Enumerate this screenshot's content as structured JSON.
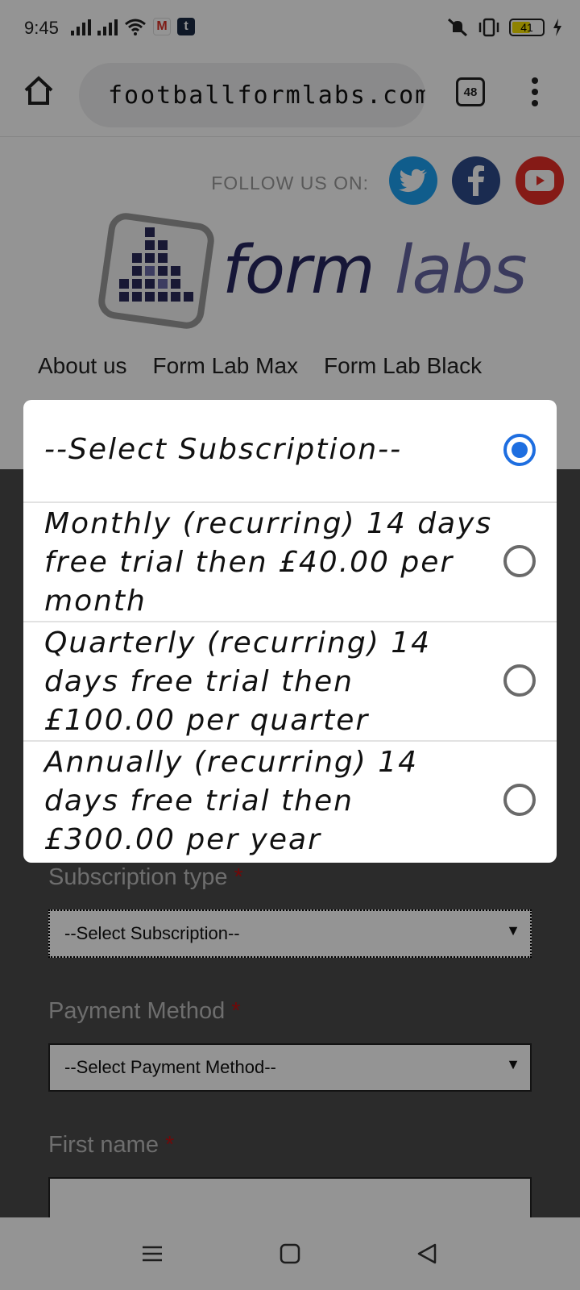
{
  "status_bar": {
    "time": "9:45",
    "battery_level": "41",
    "gmail_letter": "M",
    "tumblr_letter": "t",
    "icons": [
      "signal-icon",
      "signal-icon",
      "wifi-icon",
      "gmail-icon",
      "tumblr-icon",
      "mute-icon",
      "vibrate-icon",
      "battery-icon",
      "charging-icon"
    ]
  },
  "browser": {
    "url": "footballformlabs.com/R",
    "tab_count": "48",
    "icons": [
      "home-icon",
      "warning-icon",
      "tabs-icon",
      "more-icon"
    ]
  },
  "header": {
    "follow_label": "FOLLOW US ON:",
    "social": [
      "twitter-icon",
      "facebook-icon",
      "youtube-icon"
    ],
    "social_colors": {
      "twitter": "#1da1f2",
      "facebook": "#2d4a8a",
      "youtube": "#e52d27"
    },
    "logo_text_form": "form",
    "logo_text_labs": " labs"
  },
  "nav": {
    "items": [
      {
        "label": "About us"
      },
      {
        "label": "Form Lab Max"
      },
      {
        "label": "Form Lab Black"
      }
    ]
  },
  "form": {
    "subscription_label": "Subscription type",
    "subscription_value": "--Select Subscription--",
    "payment_label": "Payment Method",
    "payment_value": "--Select Payment Method--",
    "first_name_label": "First name",
    "required_mark": "*"
  },
  "dialog": {
    "selected_index": 0,
    "options": [
      {
        "label": "--Select Subscription--"
      },
      {
        "label": "Monthly (recurring) 14 days free trial then £40.00 per month"
      },
      {
        "label": "Quarterly (recurring) 14 days free trial then £100.00 per quarter"
      },
      {
        "label": "Annually (recurring) 14 days free trial then £300.00 per year"
      }
    ],
    "accent_color": "#1e6ee0"
  },
  "bottom_nav": [
    "menu-icon",
    "home-square-icon",
    "back-icon"
  ]
}
